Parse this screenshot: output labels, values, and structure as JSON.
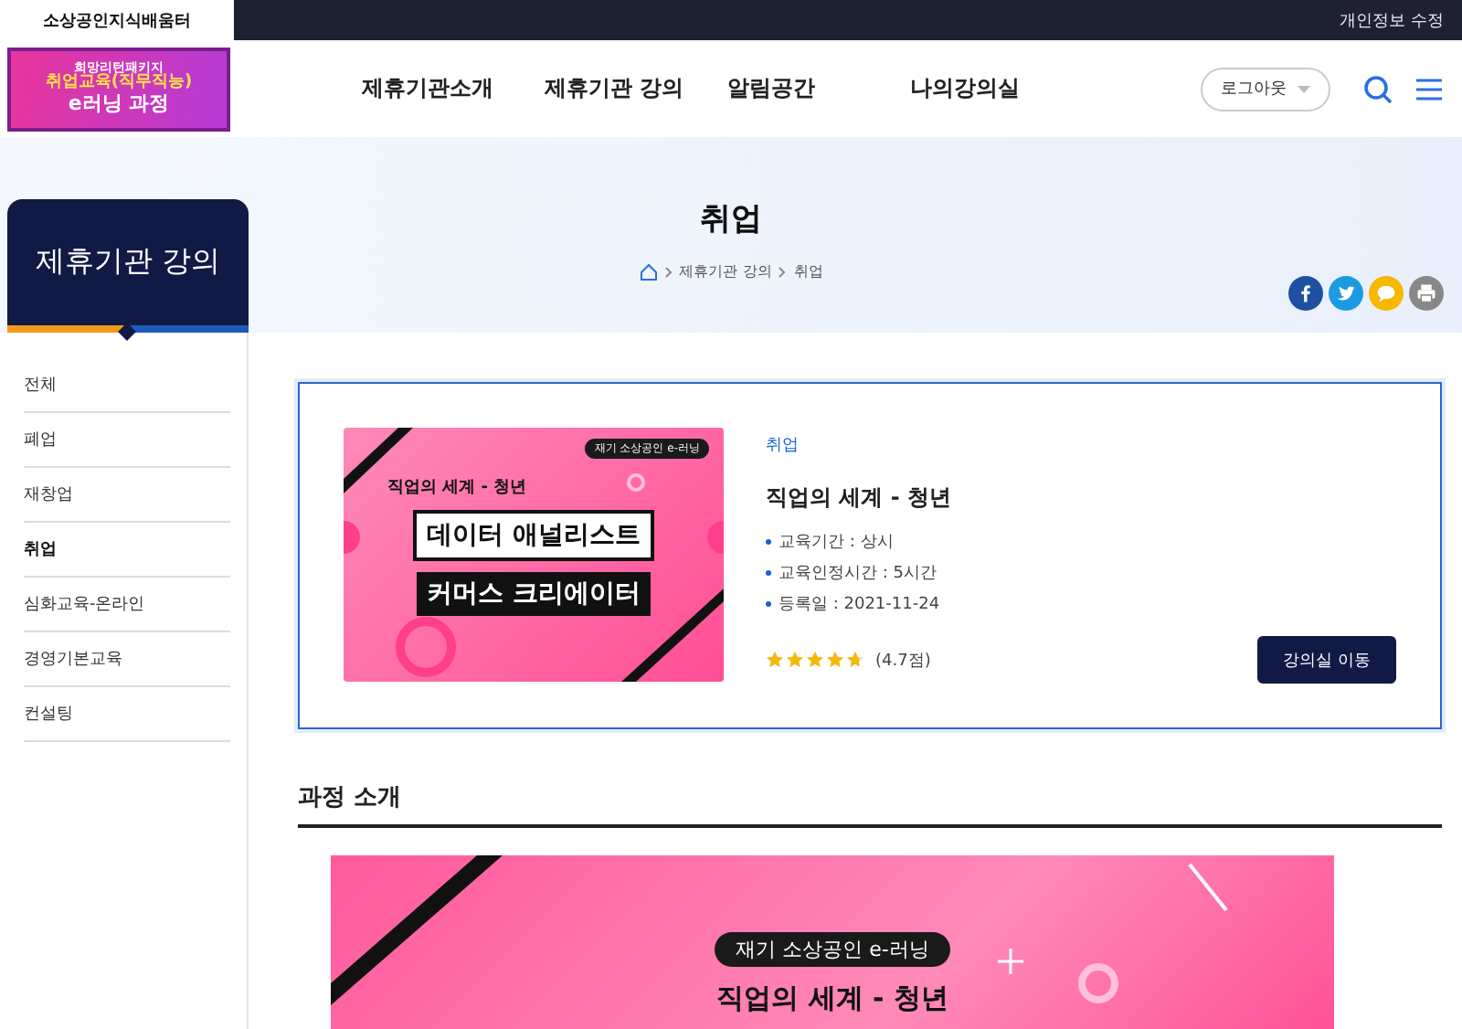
{
  "top_bar": {
    "site_tab": "소상공인지식배움터",
    "profile_link": "개인정보 수정"
  },
  "logo": {
    "line_1": "희망리턴패키지",
    "line_2": "취업교육(직무직능)",
    "line_3": "e러닝 과정"
  },
  "nav": {
    "items": [
      {
        "label": "제휴기관소개",
        "selected": false
      },
      {
        "label": "제휴기관 강의",
        "selected": false
      },
      {
        "label": "알림공간",
        "selected": false
      },
      {
        "label": "나의강의실",
        "selected": false
      }
    ],
    "logout": "로그아웃"
  },
  "hero": {
    "title": "취업",
    "breadcrumb": [
      "제휴기관 강의",
      "취업"
    ]
  },
  "sidebar": {
    "title": "제휴기관 강의",
    "items": [
      {
        "label": "전체",
        "selected": false
      },
      {
        "label": "폐업",
        "selected": false
      },
      {
        "label": "재창업",
        "selected": false
      },
      {
        "label": "취업",
        "selected": true
      },
      {
        "label": "심화교육-온라인",
        "selected": false
      },
      {
        "label": "경영기본교육",
        "selected": false
      },
      {
        "label": "컨설팅",
        "selected": false
      }
    ]
  },
  "course": {
    "thumbnail": {
      "badge": "재기 소상공인 e-러닝",
      "subtitle": "직업의 세계 - 청년",
      "label_1": "데이터 애널리스트",
      "label_2": "커머스 크리에이터"
    },
    "category": "취업",
    "title": "직업의 세계 - 청년",
    "details": [
      "교육기간 : 상시",
      "교육인정시간 : 5시간",
      "등록일 : 2021-11-24"
    ],
    "stars": 4.7,
    "rating": "(4.7점)",
    "button": "강의실 이동"
  },
  "intro": {
    "heading": "과정 소개",
    "banner": {
      "badge": "재기 소상공인 e-러닝",
      "subtitle": "직업의 세계 - 청년"
    }
  }
}
